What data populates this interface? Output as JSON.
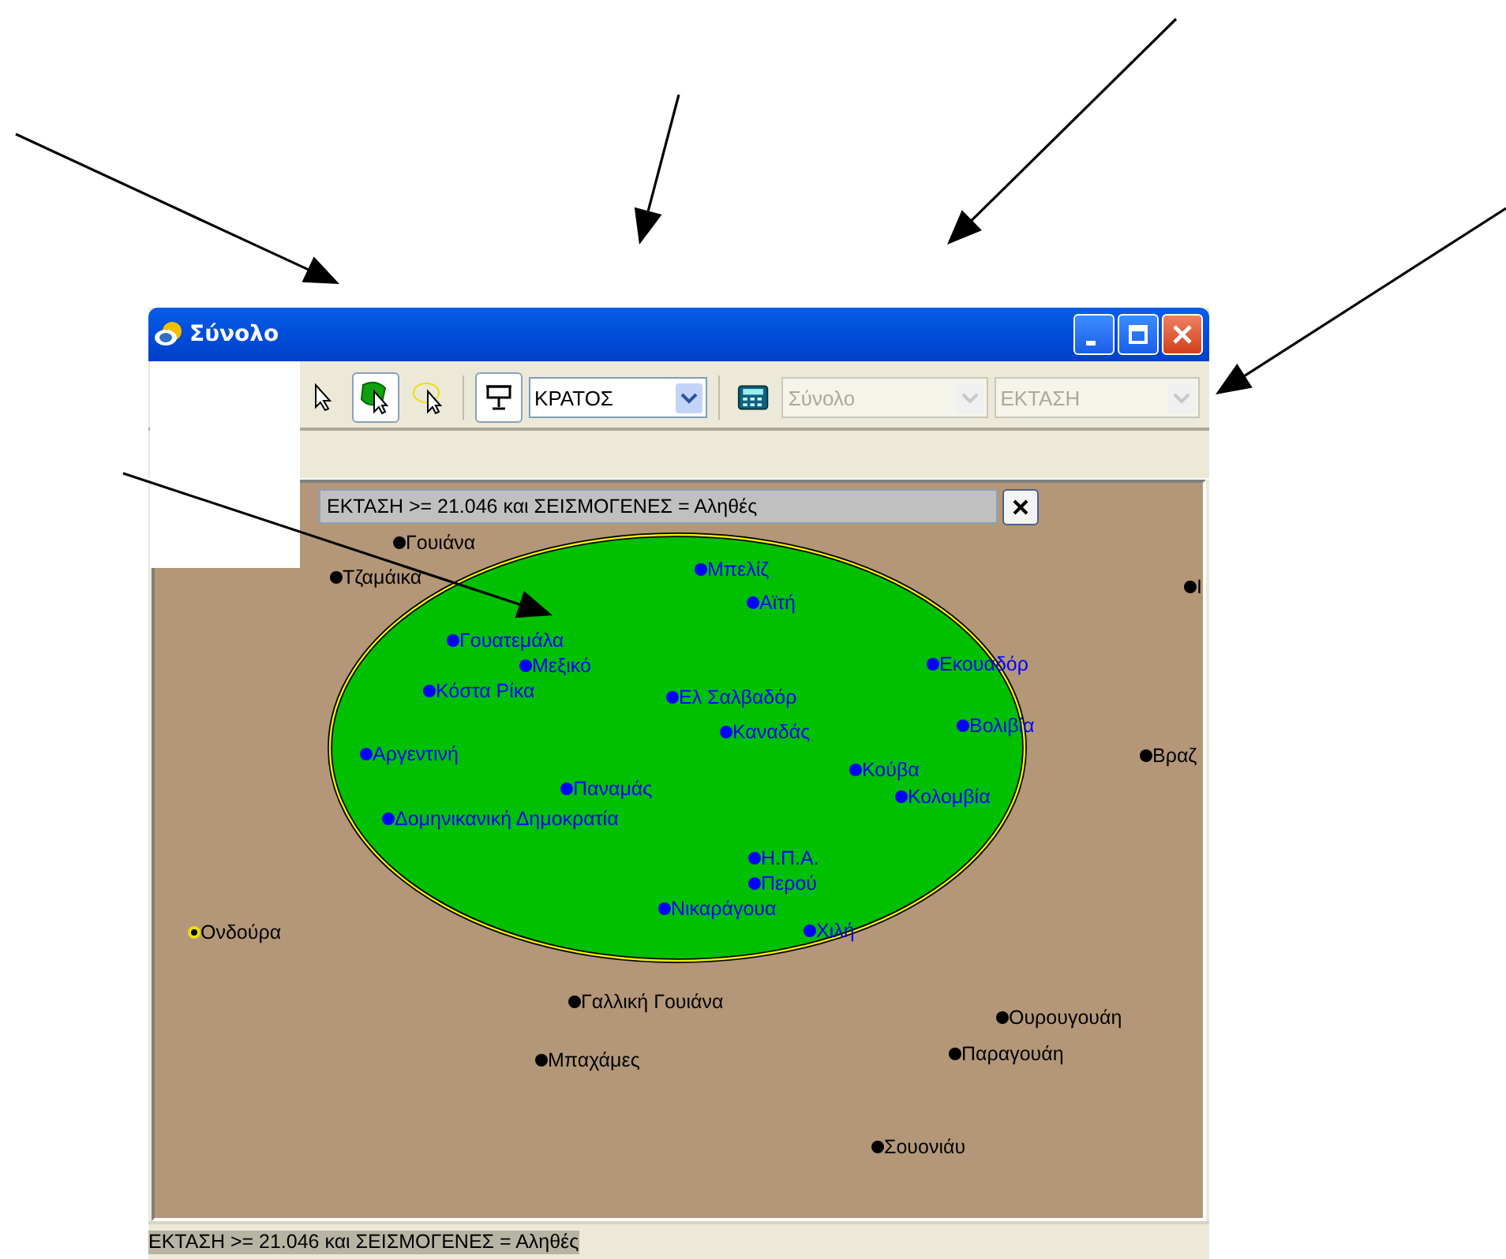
{
  "window": {
    "title": "Σύνολο"
  },
  "toolbar": {
    "tools": [
      {
        "kind": "pointer",
        "selected": false
      },
      {
        "kind": "region-select",
        "selected": true
      },
      {
        "kind": "ellipse-select",
        "selected": false
      },
      {
        "kind": "display",
        "selected": true
      }
    ],
    "layer_dropdown": {
      "value": "ΚΡΑΤΟΣ",
      "disabled": false
    },
    "stat_dropdowns": [
      {
        "value": "Σύνολο",
        "disabled": true
      },
      {
        "value": "ΕΚΤΑΣΗ",
        "disabled": true
      }
    ]
  },
  "filter_bar": {
    "text": "ΕΚΤΑΣΗ >= 21.046 και ΣΕΙΣΜΟΓΕΝΕΣ = Αληθές"
  },
  "map": {
    "points": [
      {
        "label": "Γουιάνα",
        "color": "#000000",
        "highlighted": false
      },
      {
        "label": "Τζαμάικα",
        "color": "#000000",
        "highlighted": false
      },
      {
        "label": "Μπελίζ",
        "color": "#0000ff",
        "highlighted": false
      },
      {
        "label": "Αϊτή",
        "color": "#0000ff",
        "highlighted": false
      },
      {
        "label": "Γουατεμάλα",
        "color": "#0000ff",
        "highlighted": false
      },
      {
        "label": "Κόστα Ρίκα",
        "color": "#0000ff",
        "highlighted": false
      },
      {
        "label": "Μεξικό",
        "color": "#0000ff",
        "highlighted": false
      },
      {
        "label": "Ελ Σαλβαδόρ",
        "color": "#0000ff",
        "highlighted": false
      },
      {
        "label": "Καναδάς",
        "color": "#0000ff",
        "highlighted": false
      },
      {
        "label": "Εκουαδόρ",
        "color": "#0000ff",
        "highlighted": false
      },
      {
        "label": "Βολιβία",
        "color": "#0000ff",
        "highlighted": false
      },
      {
        "label": "Αργεντινή",
        "color": "#0000ff",
        "highlighted": false
      },
      {
        "label": "Κούβα",
        "color": "#0000ff",
        "highlighted": false
      },
      {
        "label": "Κολομβία",
        "color": "#0000ff",
        "highlighted": false
      },
      {
        "label": "Παναμάς",
        "color": "#0000ff",
        "highlighted": false
      },
      {
        "label": "Δομηνικανική Δημοκρατία",
        "color": "#0000ff",
        "highlighted": false
      },
      {
        "label": "Η.Π.Α.",
        "color": "#0000ff",
        "highlighted": false
      },
      {
        "label": "Περού",
        "color": "#0000ff",
        "highlighted": false
      },
      {
        "label": "Νικαράγουα",
        "color": "#0000ff",
        "highlighted": false
      },
      {
        "label": "Χιλή",
        "color": "#0000ff",
        "highlighted": false
      },
      {
        "label": "Ι",
        "color": "#000000",
        "highlighted": false
      },
      {
        "label": "Βραζ",
        "color": "#000000",
        "highlighted": false
      },
      {
        "label": "Ονδούρα",
        "color": "#000000",
        "highlighted": true
      },
      {
        "label": "Γαλλική Γουιάνα",
        "color": "#000000",
        "highlighted": false
      },
      {
        "label": "Μπαχάμες",
        "color": "#000000",
        "highlighted": false
      },
      {
        "label": "Ουρουγουάη",
        "color": "#000000",
        "highlighted": false
      },
      {
        "label": "Παραγουάη",
        "color": "#000000",
        "highlighted": false
      },
      {
        "label": "Σουονιάυ",
        "color": "#000000",
        "highlighted": false
      }
    ]
  },
  "status_bar": {
    "text": "ΕΚΤΑΣΗ >= 21.046 και ΣΕΙΣΜΟΓΕΝΕΣ = Αληθές"
  }
}
